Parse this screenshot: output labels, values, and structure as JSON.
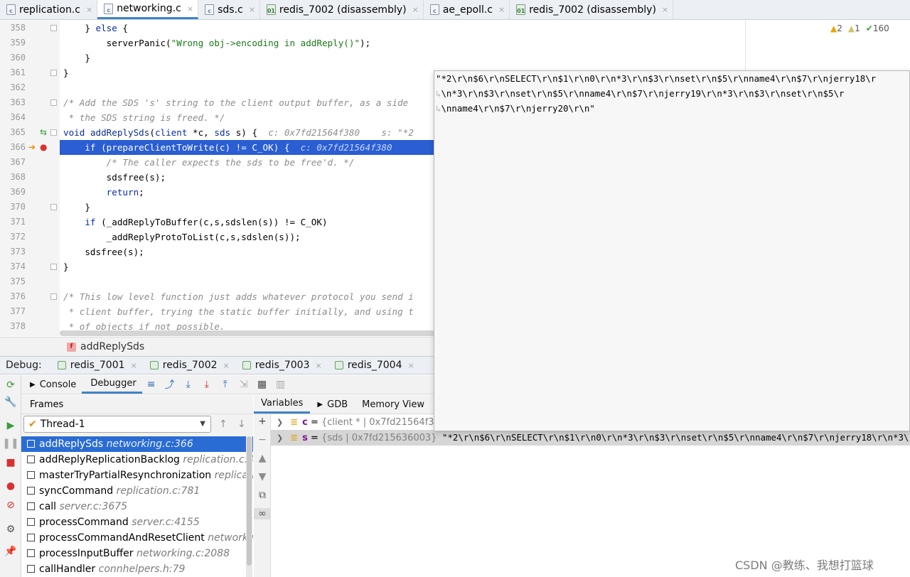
{
  "tabs": [
    {
      "label": "replication.c",
      "icon": "c-file-icon",
      "icon_text": "c",
      "active": false
    },
    {
      "label": "networking.c",
      "icon": "c-file-icon",
      "icon_text": "c",
      "active": true
    },
    {
      "label": "sds.c",
      "icon": "c-file-icon",
      "icon_text": "c",
      "active": false
    },
    {
      "label": "redis_7002 (disassembly)",
      "icon": "asm-file-icon",
      "icon_text": "01",
      "active": false
    },
    {
      "label": "ae_epoll.c",
      "icon": "c-file-icon",
      "icon_text": "c",
      "active": false
    },
    {
      "label": "redis_7002 (disassembly)",
      "icon": "asm-file-icon",
      "icon_text": "01",
      "active": false
    }
  ],
  "inspection": {
    "warnings": "2",
    "weak_warnings": "1",
    "ok": "160"
  },
  "editor": {
    "lines": [
      {
        "n": "358",
        "html": "    } <span class=\"kw\">else</span> {"
      },
      {
        "n": "359",
        "html": "        serverPanic(<span class=\"str\">\"Wrong obj->encoding in addReply()\"</span>);"
      },
      {
        "n": "360",
        "html": "    }"
      },
      {
        "n": "361",
        "html": "}"
      },
      {
        "n": "362",
        "html": ""
      },
      {
        "n": "363",
        "html": "<span class=\"cmt\">/* Add the SDS 's' string to the client output buffer, as a side</span>"
      },
      {
        "n": "364",
        "html": "<span class=\"cmt\"> * the SDS string is freed. */</span>"
      },
      {
        "n": "365",
        "html": "<span class=\"kw\">void</span> <span class=\"fn\">addReplySds</span>(<span class=\"kw\">client</span> *c, <span class=\"kw\">sds</span> s) {  <span class=\"hint\">c: 0x7fd21564f380    s: \"*2</span>"
      },
      {
        "n": "366",
        "html": "    <span class=\"kw\">if</span> (prepareClientToWrite(c) != C_OK) {  <span class=\"hint\">c: 0x7fd21564f380</span>",
        "highlight": true
      },
      {
        "n": "367",
        "html": "        <span class=\"cmt\">/* The caller expects the sds to be free'd. */</span>"
      },
      {
        "n": "368",
        "html": "        sdsfree(s);"
      },
      {
        "n": "369",
        "html": "        <span class=\"kw\">return</span>;"
      },
      {
        "n": "370",
        "html": "    }"
      },
      {
        "n": "371",
        "html": "    <span class=\"kw\">if</span> (_addReplyToBuffer(c,s,sdslen(s)) != C_OK)"
      },
      {
        "n": "372",
        "html": "        _addReplyProtoToList(c,s,sdslen(s));"
      },
      {
        "n": "373",
        "html": "    sdsfree(s);"
      },
      {
        "n": "374",
        "html": "}"
      },
      {
        "n": "375",
        "html": ""
      },
      {
        "n": "376",
        "html": "<span class=\"cmt\">/* This low level function just adds whatever protocol you send i</span>"
      },
      {
        "n": "377",
        "html": "<span class=\"cmt\"> * client buffer, trying the static buffer initially, and using t</span>"
      },
      {
        "n": "378",
        "html": "<span class=\"cmt\"> * of objects if not possible.</span>"
      }
    ]
  },
  "breadcrumb": {
    "icon_text": "f",
    "label": "addReplySds"
  },
  "debug": {
    "label": "Debug:",
    "sessions": [
      "redis_7001",
      "redis_7002",
      "redis_7003",
      "redis_7004"
    ],
    "close_glyph": "×"
  },
  "debugger_tabs": {
    "console": "Console",
    "debugger": "Debugger"
  },
  "frames": {
    "header": "Frames",
    "thread": "Thread-1",
    "items": [
      {
        "fn": "addReplySds",
        "loc": "networking.c:366",
        "selected": true
      },
      {
        "fn": "addReplyReplicationBacklog",
        "loc": "replication.c:46"
      },
      {
        "fn": "masterTryPartialResynchronization",
        "loc": "replicati"
      },
      {
        "fn": "syncCommand",
        "loc": "replication.c:781"
      },
      {
        "fn": "call",
        "loc": "server.c:3675"
      },
      {
        "fn": "processCommand",
        "loc": "server.c:4155"
      },
      {
        "fn": "processCommandAndResetClient",
        "loc": "networkin"
      },
      {
        "fn": "processInputBuffer",
        "loc": "networking.c:2088"
      },
      {
        "fn": "callHandler",
        "loc": "connhelpers.h:79"
      }
    ]
  },
  "variables": {
    "tabs": [
      "Variables",
      "GDB",
      "Memory View"
    ],
    "rows": [
      {
        "name": "c",
        "eq": " = ",
        "type": "{client * | 0x7fd21564f38",
        "value": ""
      },
      {
        "name": "s",
        "eq": " = ",
        "type": "{sds | 0x7fd215636003}",
        "value": " \"*2\\r\\n$6\\r\\nSELECT\\r\\n$1\\r\\n0\\r\\n*3\\r\\n$3\\r\\nset\\r\\n$5\\r\\nname4\\r\\n$7\\r\\njerry18\\r\\n*3\\r\\n$"
      }
    ]
  },
  "popup": {
    "lines": [
      "\"*2\\r\\n$6\\r\\nSELECT\\r\\n$1\\r\\n0\\r\\n*3\\r\\n$3\\r\\nset\\r\\n$5\\r\\nname4\\r\\n$7\\r\\njerry18\\r",
      "\\n*3\\r\\n$3\\r\\nset\\r\\n$5\\r\\nname4\\r\\n$7\\r\\njerry19\\r\\n*3\\r\\n$3\\r\\nset\\r\\n$5\\r",
      "\\nname4\\r\\n$7\\r\\njerry20\\r\\n\""
    ]
  },
  "watermark": "CSDN @教练、我想打篮球",
  "colors": {
    "accent": "#4083c9",
    "selection": "#2a6cd4",
    "current_line": "#2a5ed2"
  }
}
